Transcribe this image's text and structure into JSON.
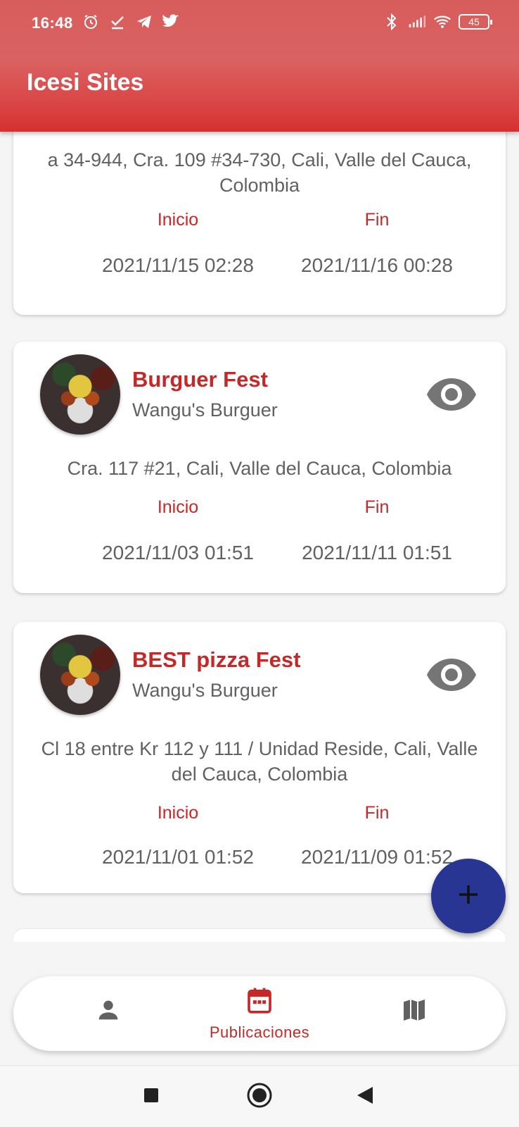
{
  "status_bar": {
    "time": "16:48",
    "battery": "45",
    "left_icons": [
      "alarm-icon",
      "check-icon",
      "telegram-icon",
      "twitter-icon"
    ],
    "right_icons": [
      "bluetooth-icon",
      "signal-icon",
      "wifi-icon",
      "battery-icon"
    ]
  },
  "app_bar": {
    "title": "Icesi Sites",
    "color": "#d9534f"
  },
  "labels": {
    "start": "Inicio",
    "end": "Fin"
  },
  "publications": [
    {
      "name": "",
      "organizer": "",
      "address": "a 34-944, Cra. 109 #34-730, Cali, Valle del Cauca, Colombia",
      "start": "2021/11/15 02:28",
      "end": "2021/11/16 00:28"
    },
    {
      "name": "Burguer Fest",
      "organizer": "Wangu's Burguer",
      "address": "Cra. 117 #21, Cali, Valle del Cauca, Colombia",
      "start": "2021/11/03 01:51",
      "end": "2021/11/11 01:51"
    },
    {
      "name": "BEST pizza Fest",
      "organizer": "Wangu's Burguer",
      "address": "Cl 18 entre Kr 112 y 111 / Unidad Reside, Cali, Valle del Cauca, Colombia",
      "start": "2021/11/01 01:52",
      "end": "2021/11/09 01:52"
    }
  ],
  "fab": {
    "icon": "plus-icon",
    "color": "#283593"
  },
  "bottom_nav": {
    "items": [
      {
        "icon": "person-icon",
        "label": ""
      },
      {
        "icon": "calendar-icon",
        "label": "Publicaciones",
        "active": true
      },
      {
        "icon": "map-icon",
        "label": ""
      }
    ],
    "active_color": "#c62828"
  },
  "system_nav": [
    "recents-button",
    "home-button",
    "back-button"
  ]
}
